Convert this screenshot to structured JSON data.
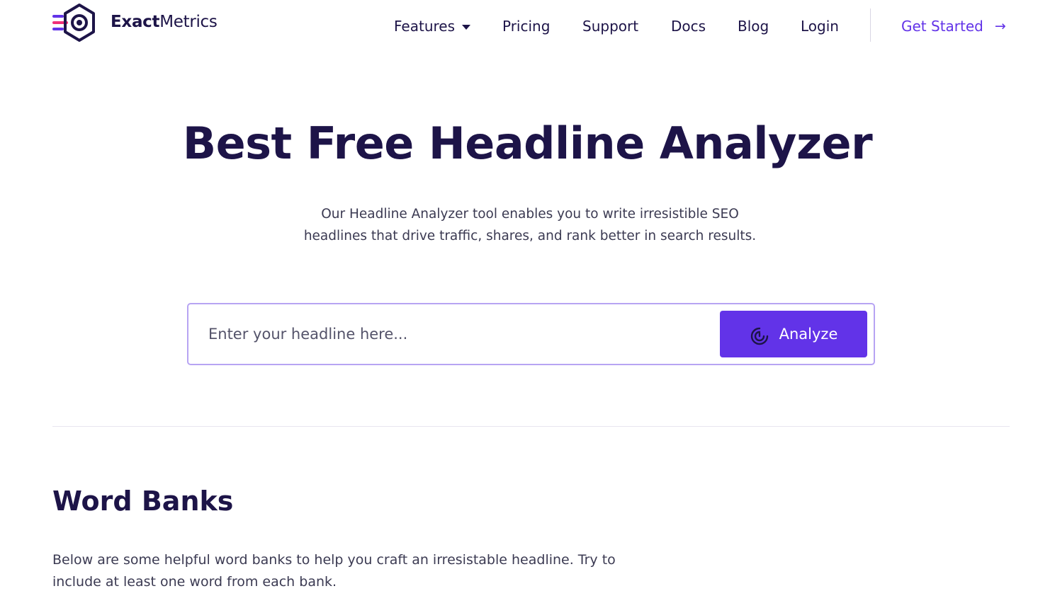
{
  "header": {
    "logo": {
      "brand_bold": "Exact",
      "brand_regular": "Metrics"
    },
    "nav": [
      {
        "label": "Features",
        "has_dropdown": true
      },
      {
        "label": "Pricing"
      },
      {
        "label": "Support"
      },
      {
        "label": "Docs"
      },
      {
        "label": "Blog"
      },
      {
        "label": "Login"
      }
    ],
    "cta": {
      "label": "Get Started",
      "icon": "arrow-right-icon",
      "arrow": "→"
    }
  },
  "hero": {
    "title": "Best Free Headline Analyzer",
    "subtitle": "Our Headline Analyzer tool enables you to write irresistible SEO headlines that drive traffic, shares, and rank better in search results.",
    "search": {
      "placeholder": "Enter your headline here...",
      "value": "",
      "button_label": "Analyze",
      "button_icon": "analyze-target-icon"
    }
  },
  "word_banks": {
    "title": "Word Banks",
    "description": "Below are some helpful word banks to help you craft an irresistable headline. Try to include at least one word from each bank."
  },
  "colors": {
    "accent": "#6233e8",
    "heading": "#1d1448",
    "body_text": "#3b3a52",
    "input_border": "#b7a4f3",
    "logo_stripe_pink": "#f0307a",
    "logo_stripe_purple": "#6233e8"
  }
}
